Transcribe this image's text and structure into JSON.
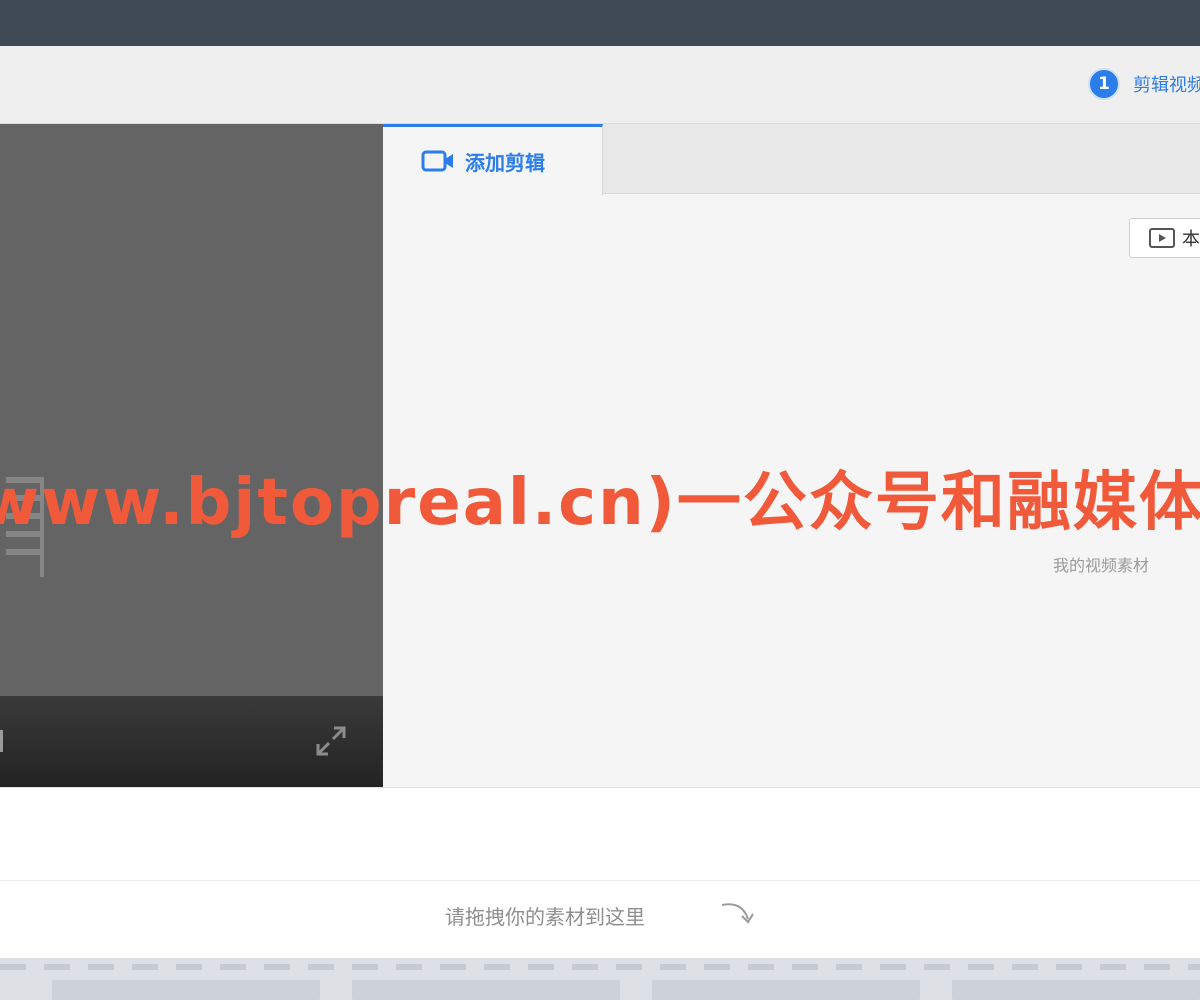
{
  "steps": [
    {
      "number": "1",
      "label": "剪辑视频"
    }
  ],
  "tabs": [
    {
      "label": "添加剪辑",
      "icon": "video-camera-icon",
      "active": true
    }
  ],
  "material_panel": {
    "local_button_label": "本地",
    "my_material_label": "我的视频素材"
  },
  "watermark": {
    "text": "www.bjtopreal.cn)一公众号和融媒体"
  },
  "timeline": {
    "drop_hint": "请拖拽你的素材到这里"
  },
  "colors": {
    "accent": "#2b7de9",
    "top_bar": "#3f4954",
    "watermark": "#f05a3a",
    "preview_bg": "#646464"
  }
}
